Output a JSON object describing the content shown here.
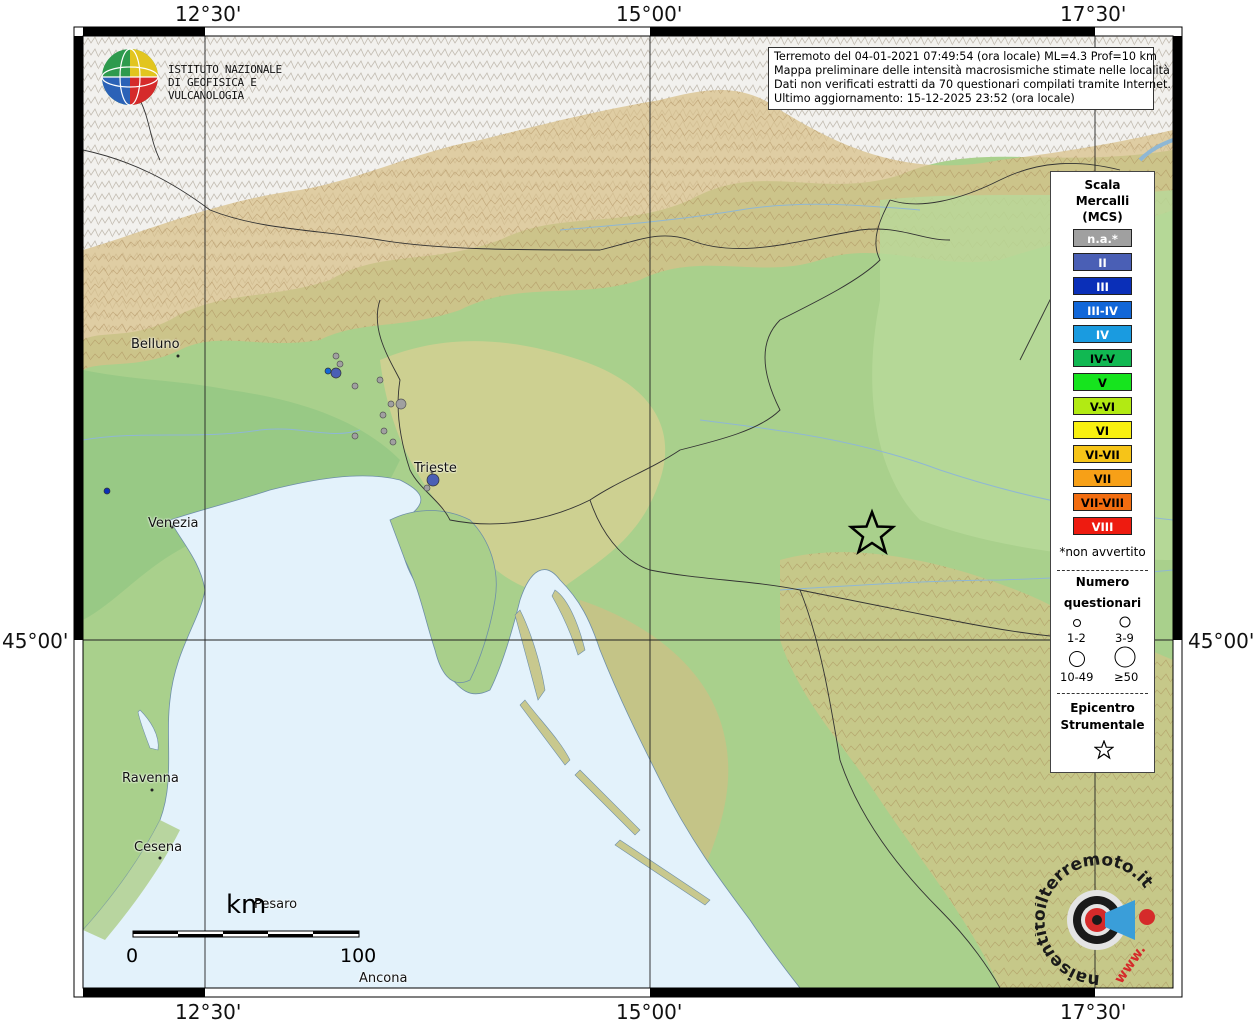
{
  "map": {
    "lat_ticks": [
      "45°00'"
    ],
    "lon_ticks": [
      "12°30'",
      "15°00'",
      "17°30'"
    ]
  },
  "info": {
    "line1": "Terremoto del 04-01-2021 07:49:54 (ora locale) ML=4.3 Prof=10 km",
    "line2": "Mappa preliminare delle intensità macrosismiche stimate nelle località",
    "line3": "Dati non verificati estratti da 70 questionari compilati tramite Internet.",
    "line4": "Ultimo aggiornamento: 15-12-2025 23:52 (ora locale)"
  },
  "logo": {
    "line1": "ISTITUTO NAZIONALE",
    "line2": "DI GEOFISICA E VULCANOLOGIA"
  },
  "legend": {
    "title1": "Scala",
    "title2": "Mercalli",
    "title3": "(MCS)",
    "scale": [
      {
        "label": "n.a.*",
        "color": "#a0a0a0",
        "text": "#ffffff"
      },
      {
        "label": "II",
        "color": "#4a5fb5",
        "text": "#ffffff"
      },
      {
        "label": "III",
        "color": "#0a2fb8",
        "text": "#ffffff"
      },
      {
        "label": "III-IV",
        "color": "#1267d8",
        "text": "#ffffff"
      },
      {
        "label": "IV",
        "color": "#1a9be0",
        "text": "#ffffff"
      },
      {
        "label": "IV-V",
        "color": "#11b852",
        "text": "#000000"
      },
      {
        "label": "V",
        "color": "#16e41e",
        "text": "#000000"
      },
      {
        "label": "V-VI",
        "color": "#b2ea13",
        "text": "#000000"
      },
      {
        "label": "VI",
        "color": "#f8f010",
        "text": "#000000"
      },
      {
        "label": "VI-VII",
        "color": "#f6c418",
        "text": "#000000"
      },
      {
        "label": "VII",
        "color": "#f7a017",
        "text": "#000000"
      },
      {
        "label": "VII-VIII",
        "color": "#f26d10",
        "text": "#000000"
      },
      {
        "label": "VIII",
        "color": "#ee1b10",
        "text": "#ffffff"
      }
    ],
    "note": "*non avvertito",
    "numero1": "Numero",
    "numero2": "questionari",
    "q1": "1-2",
    "q2": "3-9",
    "q3": "10-49",
    "q4": "≥50",
    "epi1": "Epicentro",
    "epi2": "Strumentale"
  },
  "cities": {
    "belluno": "Belluno",
    "trieste": "Trieste",
    "venezia": "Venezia",
    "ravenna": "Ravenna",
    "cesena": "Cesena",
    "pesaro": "Pesaro",
    "ancona": "Ancona"
  },
  "scalebar": {
    "unit": "km",
    "min": "0",
    "max": "100"
  },
  "hsi": {
    "text": "haisentitoilterremoto.it",
    "www": "www."
  },
  "colors": {
    "sea": "#e3f2fb",
    "lowland": "#9fcf8a",
    "hill": "#c8d89a",
    "mountain": "#d2b27a",
    "snow": "#f4f3f1"
  }
}
